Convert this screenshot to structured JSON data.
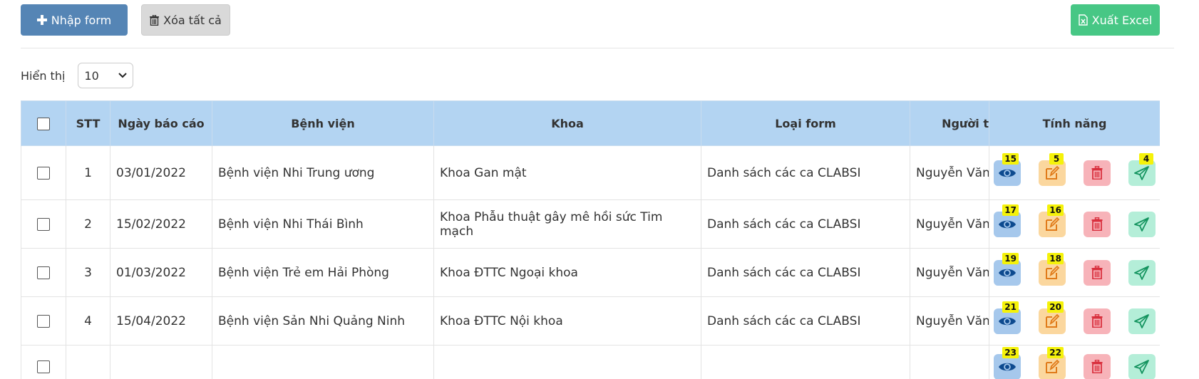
{
  "toolbar": {
    "add_label": "Nhập form",
    "clear_label": "Xóa tất cả",
    "export_label": "Xuất Excel"
  },
  "display": {
    "label": "Hiển thị",
    "page_size": "10"
  },
  "table": {
    "headers": {
      "stt": "STT",
      "date": "Ngày báo cáo",
      "hospital": "Bệnh viện",
      "dept": "Khoa",
      "form_type": "Loại form",
      "person": "Người t",
      "features": "Tính năng"
    },
    "rows": [
      {
        "stt": "1",
        "date": "03/01/2022",
        "hospital": "Bệnh viện Nhi Trung ương",
        "dept": "Khoa Gan mật",
        "form_type": "Danh sách các ca CLABSI",
        "person": "Nguyễn Văn",
        "view_count": "15",
        "edit_count": "5",
        "send_count": "4"
      },
      {
        "stt": "2",
        "date": "15/02/2022",
        "hospital": "Bệnh viện Nhi Thái Bình",
        "dept": "Khoa Phẫu thuật gây mê hồi sức Tim mạch",
        "form_type": "Danh sách các ca CLABSI",
        "person": "Nguyễn Văn",
        "view_count": "17",
        "edit_count": "16",
        "send_count": ""
      },
      {
        "stt": "3",
        "date": "01/03/2022",
        "hospital": "Bệnh viện Trẻ em Hải Phòng",
        "dept": "Khoa ĐTTC Ngoại khoa",
        "form_type": "Danh sách các ca CLABSI",
        "person": "Nguyễn Văn",
        "view_count": "19",
        "edit_count": "18",
        "send_count": ""
      },
      {
        "stt": "4",
        "date": "15/04/2022",
        "hospital": "Bệnh viện Sản Nhi Quảng Ninh",
        "dept": "Khoa ĐTTC Nội khoa",
        "form_type": "Danh sách các ca CLABSI",
        "person": "Nguyễn Văn",
        "view_count": "21",
        "edit_count": "20",
        "send_count": ""
      },
      {
        "stt": "",
        "date": "",
        "hospital": "",
        "dept": "",
        "form_type": "",
        "person": "",
        "view_count": "23",
        "edit_count": "22",
        "send_count": ""
      }
    ]
  },
  "colors": {
    "primary": "#5585b5",
    "excel": "#47c785",
    "header_bg": "#b3d4f2",
    "badge": "#f5f20a"
  }
}
